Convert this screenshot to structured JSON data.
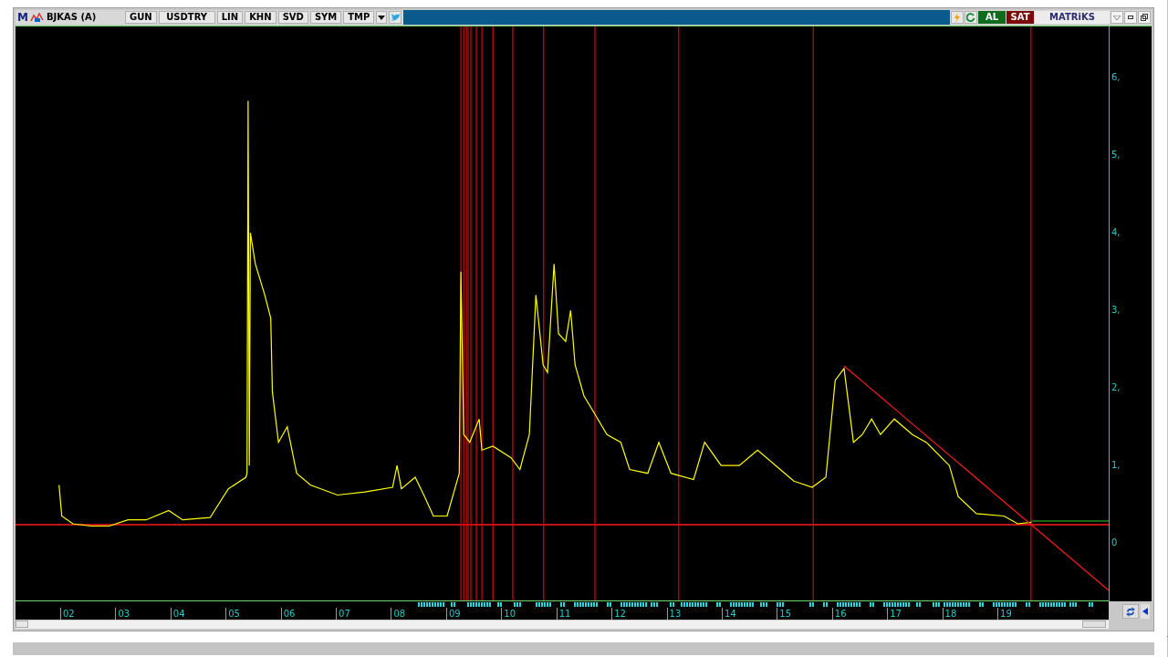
{
  "toolbar": {
    "logo": "M",
    "symbol": "BJKAS (A)",
    "buttons": [
      "GUN",
      "USDTRY",
      "LIN",
      "KHN",
      "SVD",
      "SYM",
      "TMP"
    ],
    "buy": "AL",
    "sell": "SAT",
    "brand": "MATRiKS"
  },
  "chart": {
    "chart_data": {
      "type": "line",
      "x": [
        2001.83,
        2001.88,
        2002.08,
        2002.41,
        2002.74,
        2003.08,
        2003.41,
        2003.82,
        2004.07,
        2004.57,
        2004.9,
        2005.22,
        2005.24,
        2005.26,
        2005.28,
        2005.3,
        2005.39,
        2005.56,
        2005.67,
        2005.7,
        2005.81,
        2005.97,
        2006.14,
        2006.39,
        2006.88,
        2007.38,
        2007.88,
        2007.96,
        2008.04,
        2008.29,
        2008.46,
        2008.62,
        2008.87,
        2009.09,
        2009.12,
        2009.17,
        2009.28,
        2009.45,
        2009.5,
        2009.7,
        2010.03,
        2010.19,
        2010.36,
        2010.48,
        2010.61,
        2010.69,
        2010.81,
        2010.89,
        2011.02,
        2011.11,
        2011.19,
        2011.35,
        2011.52,
        2011.77,
        2012.02,
        2012.18,
        2012.51,
        2012.71,
        2012.93,
        2013.34,
        2013.54,
        2013.84,
        2014.17,
        2014.5,
        2014.83,
        2015.16,
        2015.49,
        2015.74,
        2015.91,
        2016.07,
        2016.24,
        2016.4,
        2016.57,
        2016.73,
        2016.98,
        2017.31,
        2017.56,
        2017.98,
        2018.14,
        2018.47,
        2018.97,
        2019.22,
        2019.47,
        2020.87
      ],
      "series": [
        {
          "color": "#ffff00",
          "values": [
            0.75,
            0.35,
            0.25,
            0.22,
            0.22,
            0.3,
            0.3,
            0.42,
            0.3,
            0.33,
            0.7,
            0.85,
            0.9,
            5.7,
            1.0,
            4.0,
            3.6,
            3.2,
            2.9,
            1.95,
            1.3,
            1.5,
            0.9,
            0.75,
            0.62,
            0.66,
            0.72,
            1.0,
            0.7,
            0.85,
            0.6,
            0.35,
            0.35,
            0.9,
            3.5,
            1.4,
            1.3,
            1.6,
            1.2,
            1.25,
            1.1,
            0.95,
            1.4,
            3.2,
            2.3,
            2.2,
            3.6,
            2.7,
            2.6,
            3.0,
            2.3,
            1.9,
            1.7,
            1.4,
            1.3,
            0.95,
            0.9,
            1.3,
            0.9,
            0.82,
            1.3,
            1.0,
            1.0,
            1.2,
            1.0,
            0.8,
            0.72,
            0.85,
            2.1,
            2.25,
            1.3,
            1.4,
            1.6,
            1.4,
            1.6,
            1.4,
            1.3,
            1.0,
            0.6,
            0.38,
            0.35,
            0.25,
            0.27,
            null
          ]
        },
        {
          "color": "#33cc33",
          "values": [
            null,
            null,
            null,
            null,
            null,
            null,
            null,
            null,
            null,
            null,
            null,
            null,
            null,
            null,
            null,
            null,
            null,
            null,
            null,
            null,
            null,
            null,
            null,
            null,
            null,
            null,
            null,
            null,
            null,
            null,
            null,
            null,
            null,
            null,
            null,
            null,
            null,
            null,
            null,
            null,
            null,
            null,
            null,
            null,
            null,
            null,
            null,
            null,
            null,
            null,
            null,
            null,
            null,
            null,
            null,
            null,
            null,
            null,
            null,
            null,
            null,
            null,
            null,
            null,
            null,
            null,
            null,
            null,
            null,
            null,
            null,
            null,
            null,
            null,
            null,
            null,
            null,
            null,
            null,
            null,
            null,
            null,
            0.285,
            0.285
          ]
        },
        {
          "color": "#ff1a1a",
          "values": [
            null,
            null,
            null,
            null,
            null,
            null,
            null,
            null,
            null,
            null,
            null,
            null,
            null,
            null,
            null,
            null,
            null,
            null,
            null,
            null,
            null,
            null,
            null,
            null,
            null,
            null,
            null,
            null,
            null,
            null,
            null,
            null,
            null,
            null,
            null,
            null,
            null,
            null,
            null,
            null,
            null,
            null,
            null,
            null,
            null,
            null,
            null,
            null,
            null,
            null,
            null,
            null,
            null,
            null,
            null,
            null,
            null,
            null,
            null,
            null,
            null,
            null,
            null,
            null,
            null,
            null,
            null,
            null,
            null,
            2.285,
            2.182,
            2.086,
            1.983,
            1.887,
            1.736,
            1.537,
            1.386,
            1.133,
            1.037,
            0.838,
            0.536,
            0.385,
            0.235,
            -0.61
          ]
        }
      ],
      "ref_lines": [
        {
          "axis": "y",
          "value": 0.238,
          "color": "#ff1a1a"
        },
        {
          "axis": "x",
          "value": 2009.12,
          "color": "#e00000"
        },
        {
          "axis": "x",
          "value": 2009.17,
          "color": "#e00000"
        },
        {
          "axis": "x",
          "value": 2009.22,
          "color": "#e00000"
        },
        {
          "axis": "x",
          "value": 2009.25,
          "color": "#e00000"
        },
        {
          "axis": "x",
          "value": 2009.3,
          "color": "#e00000"
        },
        {
          "axis": "x",
          "value": 2009.4,
          "color": "#e00000"
        },
        {
          "axis": "x",
          "value": 2009.5,
          "color": "#e00000"
        },
        {
          "axis": "x",
          "value": 2009.7,
          "color": "#e00000"
        },
        {
          "axis": "x",
          "value": 2010.06,
          "color": "#e00000"
        },
        {
          "axis": "x",
          "value": 2010.62,
          "color": "#e00000"
        },
        {
          "axis": "x",
          "value": 2011.55,
          "color": "#e00000"
        },
        {
          "axis": "x",
          "value": 2013.07,
          "color": "#e00000"
        },
        {
          "axis": "x",
          "value": 2015.51,
          "color": "#8a2a10"
        },
        {
          "axis": "x",
          "value": 2019.46,
          "color": "#e00000"
        }
      ],
      "xlim": [
        2001.04,
        2020.87
      ],
      "ylim": [
        -0.75,
        6.66
      ],
      "xticks": [
        {
          "value": 2002,
          "label": "02"
        },
        {
          "value": 2003,
          "label": "03"
        },
        {
          "value": 2004,
          "label": "04"
        },
        {
          "value": 2005,
          "label": "05"
        },
        {
          "value": 2006,
          "label": "06"
        },
        {
          "value": 2007,
          "label": "07"
        },
        {
          "value": 2008,
          "label": "08"
        },
        {
          "value": 2009,
          "label": "09"
        },
        {
          "value": 2010,
          "label": "10"
        },
        {
          "value": 2011,
          "label": "11"
        },
        {
          "value": 2012,
          "label": "12"
        },
        {
          "value": 2013,
          "label": "13"
        },
        {
          "value": 2014,
          "label": "14"
        },
        {
          "value": 2015,
          "label": "15"
        },
        {
          "value": 2016,
          "label": "16"
        },
        {
          "value": 2017,
          "label": "17"
        },
        {
          "value": 2018,
          "label": "18"
        },
        {
          "value": 2019,
          "label": "19"
        }
      ],
      "yticks": [
        {
          "value": 6,
          "label": "6,"
        },
        {
          "value": 5,
          "label": "5,"
        },
        {
          "value": 4,
          "label": "4,"
        },
        {
          "value": 3,
          "label": "3,"
        },
        {
          "value": 2,
          "label": "2,"
        },
        {
          "value": 1,
          "label": "1,"
        },
        {
          "value": 0,
          "label": "0"
        }
      ]
    }
  }
}
